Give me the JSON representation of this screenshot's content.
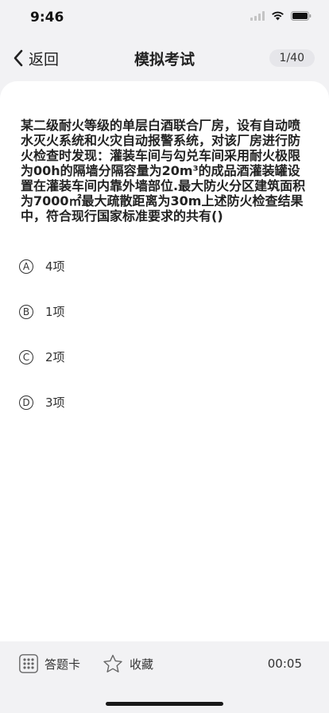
{
  "status_bar": {
    "time": "9:46"
  },
  "nav": {
    "back_label": "返回",
    "title": "模拟考试",
    "progress": "1/40"
  },
  "question": {
    "text": "某二级耐火等级的单层白酒联合厂房，设有自动喷水灭火系统和火灾自动报警系统，对该厂房进行防火检查时发现：灌装车间与勾兑车间采用耐火极限为00h的隔墙分隔容量为20m³的成品酒灌装罐设置在灌装车间内靠外墙部位.最大防火分区建筑面积为7000㎡最大疏散距离为30m上述防火检查结果中，符合现行国家标准要求的共有()"
  },
  "options": [
    {
      "letter": "A",
      "text": "4项"
    },
    {
      "letter": "B",
      "text": "1项"
    },
    {
      "letter": "C",
      "text": "2项"
    },
    {
      "letter": "D",
      "text": "3项"
    }
  ],
  "bottom_bar": {
    "answer_card_label": "答题卡",
    "favorite_label": "收藏",
    "timer": "00:05"
  },
  "icons": {
    "back": "chevron-left-icon",
    "answer_card": "grid-icon",
    "favorite": "star-icon",
    "signal": "signal-icon",
    "wifi": "wifi-icon",
    "battery": "battery-icon"
  }
}
